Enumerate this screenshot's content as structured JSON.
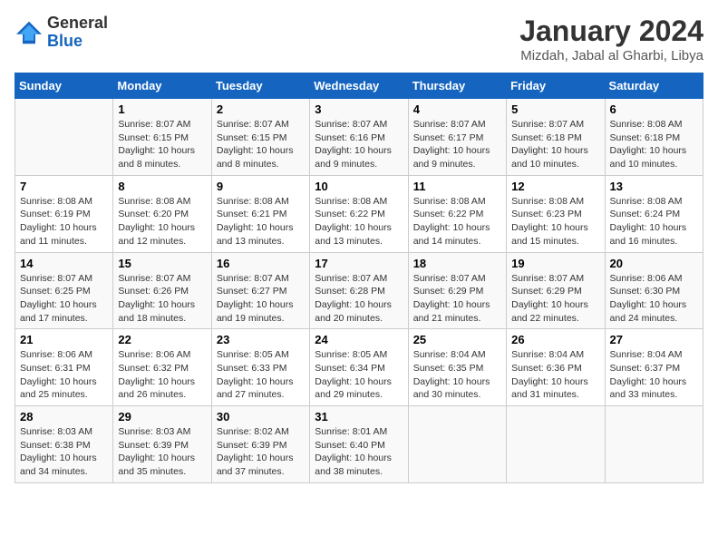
{
  "logo": {
    "line1": "General",
    "line2": "Blue"
  },
  "title": "January 2024",
  "subtitle": "Mizdah, Jabal al Gharbi, Libya",
  "header": {
    "accent_color": "#1565C0"
  },
  "columns": [
    "Sunday",
    "Monday",
    "Tuesday",
    "Wednesday",
    "Thursday",
    "Friday",
    "Saturday"
  ],
  "weeks": [
    [
      {
        "day": "",
        "sunrise": "",
        "sunset": "",
        "daylight": ""
      },
      {
        "day": "1",
        "sunrise": "Sunrise: 8:07 AM",
        "sunset": "Sunset: 6:15 PM",
        "daylight": "Daylight: 10 hours and 8 minutes."
      },
      {
        "day": "2",
        "sunrise": "Sunrise: 8:07 AM",
        "sunset": "Sunset: 6:15 PM",
        "daylight": "Daylight: 10 hours and 8 minutes."
      },
      {
        "day": "3",
        "sunrise": "Sunrise: 8:07 AM",
        "sunset": "Sunset: 6:16 PM",
        "daylight": "Daylight: 10 hours and 9 minutes."
      },
      {
        "day": "4",
        "sunrise": "Sunrise: 8:07 AM",
        "sunset": "Sunset: 6:17 PM",
        "daylight": "Daylight: 10 hours and 9 minutes."
      },
      {
        "day": "5",
        "sunrise": "Sunrise: 8:07 AM",
        "sunset": "Sunset: 6:18 PM",
        "daylight": "Daylight: 10 hours and 10 minutes."
      },
      {
        "day": "6",
        "sunrise": "Sunrise: 8:08 AM",
        "sunset": "Sunset: 6:18 PM",
        "daylight": "Daylight: 10 hours and 10 minutes."
      }
    ],
    [
      {
        "day": "7",
        "sunrise": "Sunrise: 8:08 AM",
        "sunset": "Sunset: 6:19 PM",
        "daylight": "Daylight: 10 hours and 11 minutes."
      },
      {
        "day": "8",
        "sunrise": "Sunrise: 8:08 AM",
        "sunset": "Sunset: 6:20 PM",
        "daylight": "Daylight: 10 hours and 12 minutes."
      },
      {
        "day": "9",
        "sunrise": "Sunrise: 8:08 AM",
        "sunset": "Sunset: 6:21 PM",
        "daylight": "Daylight: 10 hours and 13 minutes."
      },
      {
        "day": "10",
        "sunrise": "Sunrise: 8:08 AM",
        "sunset": "Sunset: 6:22 PM",
        "daylight": "Daylight: 10 hours and 13 minutes."
      },
      {
        "day": "11",
        "sunrise": "Sunrise: 8:08 AM",
        "sunset": "Sunset: 6:22 PM",
        "daylight": "Daylight: 10 hours and 14 minutes."
      },
      {
        "day": "12",
        "sunrise": "Sunrise: 8:08 AM",
        "sunset": "Sunset: 6:23 PM",
        "daylight": "Daylight: 10 hours and 15 minutes."
      },
      {
        "day": "13",
        "sunrise": "Sunrise: 8:08 AM",
        "sunset": "Sunset: 6:24 PM",
        "daylight": "Daylight: 10 hours and 16 minutes."
      }
    ],
    [
      {
        "day": "14",
        "sunrise": "Sunrise: 8:07 AM",
        "sunset": "Sunset: 6:25 PM",
        "daylight": "Daylight: 10 hours and 17 minutes."
      },
      {
        "day": "15",
        "sunrise": "Sunrise: 8:07 AM",
        "sunset": "Sunset: 6:26 PM",
        "daylight": "Daylight: 10 hours and 18 minutes."
      },
      {
        "day": "16",
        "sunrise": "Sunrise: 8:07 AM",
        "sunset": "Sunset: 6:27 PM",
        "daylight": "Daylight: 10 hours and 19 minutes."
      },
      {
        "day": "17",
        "sunrise": "Sunrise: 8:07 AM",
        "sunset": "Sunset: 6:28 PM",
        "daylight": "Daylight: 10 hours and 20 minutes."
      },
      {
        "day": "18",
        "sunrise": "Sunrise: 8:07 AM",
        "sunset": "Sunset: 6:29 PM",
        "daylight": "Daylight: 10 hours and 21 minutes."
      },
      {
        "day": "19",
        "sunrise": "Sunrise: 8:07 AM",
        "sunset": "Sunset: 6:29 PM",
        "daylight": "Daylight: 10 hours and 22 minutes."
      },
      {
        "day": "20",
        "sunrise": "Sunrise: 8:06 AM",
        "sunset": "Sunset: 6:30 PM",
        "daylight": "Daylight: 10 hours and 24 minutes."
      }
    ],
    [
      {
        "day": "21",
        "sunrise": "Sunrise: 8:06 AM",
        "sunset": "Sunset: 6:31 PM",
        "daylight": "Daylight: 10 hours and 25 minutes."
      },
      {
        "day": "22",
        "sunrise": "Sunrise: 8:06 AM",
        "sunset": "Sunset: 6:32 PM",
        "daylight": "Daylight: 10 hours and 26 minutes."
      },
      {
        "day": "23",
        "sunrise": "Sunrise: 8:05 AM",
        "sunset": "Sunset: 6:33 PM",
        "daylight": "Daylight: 10 hours and 27 minutes."
      },
      {
        "day": "24",
        "sunrise": "Sunrise: 8:05 AM",
        "sunset": "Sunset: 6:34 PM",
        "daylight": "Daylight: 10 hours and 29 minutes."
      },
      {
        "day": "25",
        "sunrise": "Sunrise: 8:04 AM",
        "sunset": "Sunset: 6:35 PM",
        "daylight": "Daylight: 10 hours and 30 minutes."
      },
      {
        "day": "26",
        "sunrise": "Sunrise: 8:04 AM",
        "sunset": "Sunset: 6:36 PM",
        "daylight": "Daylight: 10 hours and 31 minutes."
      },
      {
        "day": "27",
        "sunrise": "Sunrise: 8:04 AM",
        "sunset": "Sunset: 6:37 PM",
        "daylight": "Daylight: 10 hours and 33 minutes."
      }
    ],
    [
      {
        "day": "28",
        "sunrise": "Sunrise: 8:03 AM",
        "sunset": "Sunset: 6:38 PM",
        "daylight": "Daylight: 10 hours and 34 minutes."
      },
      {
        "day": "29",
        "sunrise": "Sunrise: 8:03 AM",
        "sunset": "Sunset: 6:39 PM",
        "daylight": "Daylight: 10 hours and 35 minutes."
      },
      {
        "day": "30",
        "sunrise": "Sunrise: 8:02 AM",
        "sunset": "Sunset: 6:39 PM",
        "daylight": "Daylight: 10 hours and 37 minutes."
      },
      {
        "day": "31",
        "sunrise": "Sunrise: 8:01 AM",
        "sunset": "Sunset: 6:40 PM",
        "daylight": "Daylight: 10 hours and 38 minutes."
      },
      {
        "day": "",
        "sunrise": "",
        "sunset": "",
        "daylight": ""
      },
      {
        "day": "",
        "sunrise": "",
        "sunset": "",
        "daylight": ""
      },
      {
        "day": "",
        "sunrise": "",
        "sunset": "",
        "daylight": ""
      }
    ]
  ]
}
